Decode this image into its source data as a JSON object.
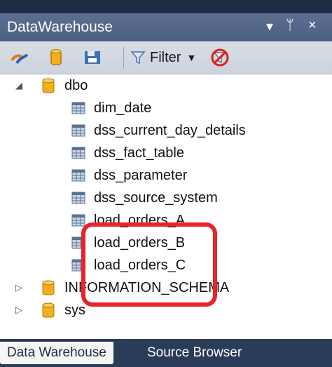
{
  "panel": {
    "title": "DataWarehouse",
    "controls": {
      "dropdown": "▾",
      "pin": "ᛘ",
      "close": "×"
    }
  },
  "toolbar": {
    "filter_label": "Filter",
    "icons": [
      "connect-icon",
      "database-icon",
      "save-icon",
      "filter-icon",
      "clear-filter-icon"
    ]
  },
  "tree": {
    "schemas": [
      {
        "name": "dbo",
        "expanded": true,
        "tables": [
          "dim_date",
          "dss_current_day_details",
          "dss_fact_table",
          "dss_parameter",
          "dss_source_system",
          "load_orders_A",
          "load_orders_B",
          "load_orders_C"
        ]
      },
      {
        "name": "INFORMATION_SCHEMA",
        "expanded": false
      },
      {
        "name": "sys",
        "expanded": false
      }
    ]
  },
  "tabs": [
    {
      "label": "Data Warehouse",
      "active": true
    },
    {
      "label": "Source Browser",
      "active": false
    }
  ],
  "colors": {
    "highlight": "#e8232b",
    "titlebar": "#4c5f82",
    "db_icon": "#f2b01e"
  }
}
